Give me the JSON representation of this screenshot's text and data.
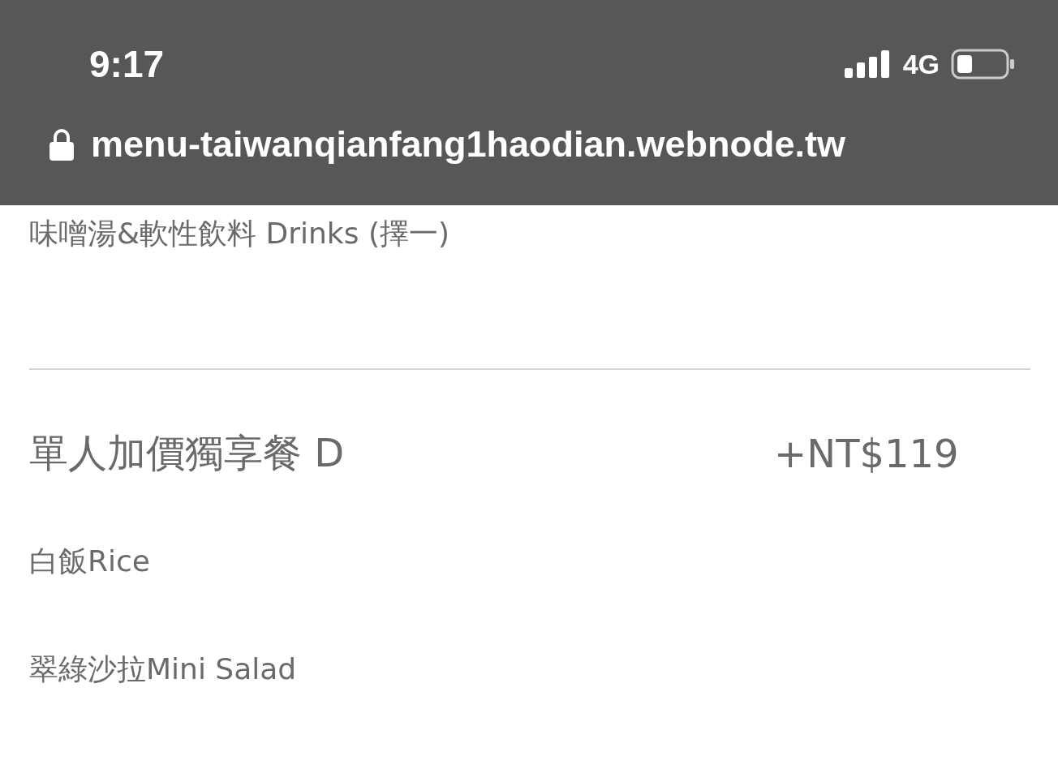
{
  "status_bar": {
    "time": "9:17",
    "network": "4G"
  },
  "address_bar": {
    "url": "menu-taiwanqianfang1haodian.webnode.tw"
  },
  "previous_items": [
    "味噌湯&軟性飲料 Drinks (擇一)"
  ],
  "sections": [
    {
      "title": "單人加價獨享餐 D",
      "price": "+NT$119",
      "items": [
        "白飯Rice",
        "翠綠沙拉Mini Salad"
      ]
    }
  ]
}
